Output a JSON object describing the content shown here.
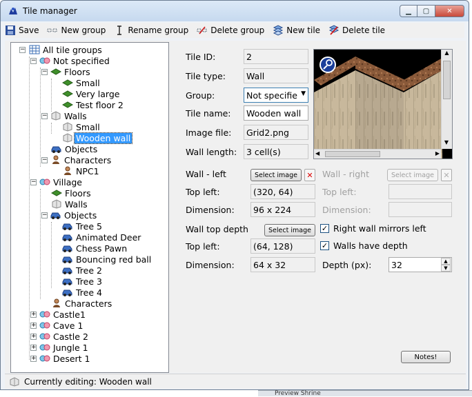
{
  "window": {
    "title": "Tile manager"
  },
  "toolbar": {
    "save": "Save",
    "new_group": "New group",
    "rename_group": "Rename group",
    "delete_group": "Delete group",
    "new_tile": "New tile",
    "delete_tile": "Delete tile"
  },
  "tree": {
    "root": "All tile groups",
    "not_specified": "Not specified",
    "floors": "Floors",
    "small": "Small",
    "very_large": "Very large",
    "test_floor_2": "Test floor 2",
    "walls": "Walls",
    "walls_small": "Small",
    "wooden_wall": "Wooden wall",
    "objects": "Objects",
    "characters": "Characters",
    "npc1": "NPC1",
    "village": "Village",
    "v_floors": "Floors",
    "v_walls": "Walls",
    "v_objects": "Objects",
    "tree5": "Tree 5",
    "animated_deer": "Animated Deer",
    "chess_pawn": "Chess Pawn",
    "bouncing_red_ball": "Bouncing red ball",
    "tree2": "Tree 2",
    "tree3": "Tree 3",
    "tree4": "Tree 4",
    "v_characters": "Characters",
    "castle1": "Castle1",
    "cave1": "Cave 1",
    "castle2": "Castle 2",
    "jungle1": "Jungle 1",
    "desert1": "Desert 1"
  },
  "form": {
    "tile_id_label": "Tile ID:",
    "tile_id": "2",
    "tile_type_label": "Tile type:",
    "tile_type": "Wall",
    "group_label": "Group:",
    "group": "Not specifie",
    "tile_name_label": "Tile name:",
    "tile_name": "Wooden wall",
    "image_file_label": "Image file:",
    "image_file": "Grid2.png",
    "wall_length_label": "Wall length:",
    "wall_length": "3 cell(s)",
    "wall_left_label": "Wall - left",
    "wall_right_label": "Wall - right",
    "select_image": "Select image",
    "top_left_label": "Top left:",
    "dimension_label": "Dimension:",
    "left_top_left": "(320, 64)",
    "left_dimension": "96 x 224",
    "wall_top_depth_label": "Wall top depth",
    "right_mirrors_label": "Right wall mirrors left",
    "walls_have_depth_label": "Walls have depth",
    "top_top_left": "(64, 128)",
    "top_dimension": "64 x 32",
    "depth_label": "Depth (px):",
    "depth": "32",
    "notes_button": "Notes!"
  },
  "status": {
    "text": "Currently editing: Wooden wall"
  },
  "behind_window": {
    "text": "Preview Shrine"
  }
}
